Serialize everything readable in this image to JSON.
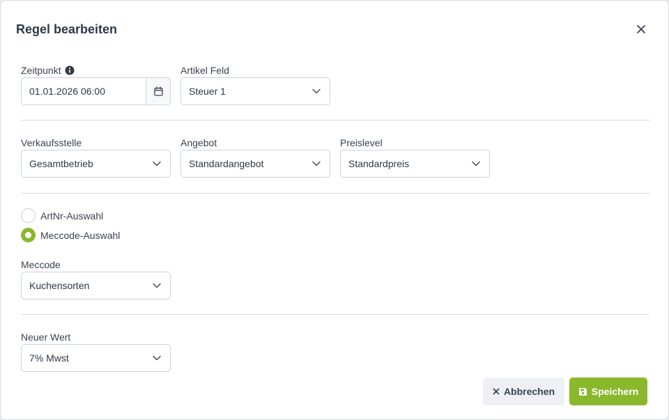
{
  "dialog": {
    "title": "Regel bearbeiten"
  },
  "fields": {
    "zeitpunkt": {
      "label": "Zeitpunkt",
      "value": "01.01.2026 06:00"
    },
    "artikel_feld": {
      "label": "Artikel Feld",
      "value": "Steuer 1"
    },
    "verkaufsstelle": {
      "label": "Verkaufsstelle",
      "value": "Gesamtbetrieb"
    },
    "angebot": {
      "label": "Angebot",
      "value": "Standardangebot"
    },
    "preislevel": {
      "label": "Preislevel",
      "value": "Standardpreis"
    },
    "meccode": {
      "label": "Meccode",
      "value": "Kuchensorten"
    },
    "neuer_wert": {
      "label": "Neuer Wert",
      "value": "7% Mwst"
    }
  },
  "selection": {
    "options": [
      {
        "label": "ArtNr-Auswahl",
        "checked": false
      },
      {
        "label": "Meccode-Auswahl",
        "checked": true
      }
    ]
  },
  "buttons": {
    "cancel": "Abbrechen",
    "save": "Speichern"
  },
  "colors": {
    "accent": "#8ab82c",
    "cancel_bg": "#eef0f4",
    "border": "#cdd2d9"
  },
  "icons": {
    "close": "close-icon",
    "info": "info-icon",
    "calendar": "calendar-icon",
    "chevron": "chevron-down-icon",
    "cancel": "x-icon",
    "save": "floppy-disk-icon"
  }
}
